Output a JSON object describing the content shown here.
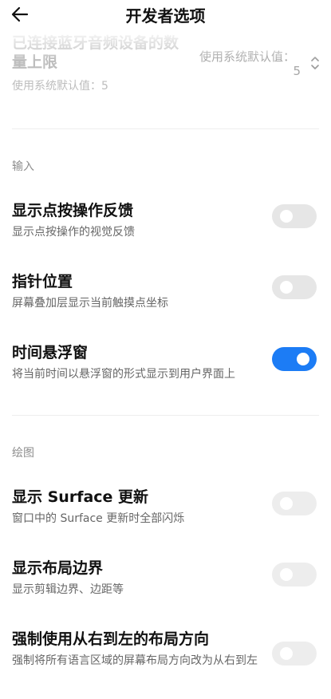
{
  "header": {
    "title": "开发者选项",
    "back_icon": "arrow-left-icon"
  },
  "bluetooth_limit": {
    "title": "已连接蓝牙音频设备的数量上限",
    "subtitle": "使用系统默认值：5",
    "value_label": "使用系统默认值：",
    "value": "5",
    "stepper_icon": "chevron-up-down-icon"
  },
  "sections": {
    "input": {
      "title": "输入",
      "show_taps": {
        "title": "显示点按操作反馈",
        "subtitle": "显示点按操作的视觉反馈",
        "on": false
      },
      "pointer_location": {
        "title": "指针位置",
        "subtitle": "屏幕叠加层显示当前触摸点坐标",
        "on": false
      },
      "time_float": {
        "title": "时间悬浮窗",
        "subtitle": "将当前时间以悬浮窗的形式显示到用户界面上",
        "on": true
      }
    },
    "drawing": {
      "title": "绘图",
      "surface_updates": {
        "title": "显示 Surface 更新",
        "subtitle": "窗口中的 Surface 更新时全部闪烁",
        "on": false
      },
      "layout_bounds": {
        "title": "显示布局边界",
        "subtitle": "显示剪辑边界、边距等",
        "on": false
      },
      "force_rtl": {
        "title": "强制使用从右到左的布局方向",
        "subtitle": "强制将所有语言区域的屏幕布局方向改为从右到左",
        "on": false
      }
    }
  },
  "colors": {
    "accent": "#1c7cf5",
    "toggle_off": "#e6e6e6"
  }
}
